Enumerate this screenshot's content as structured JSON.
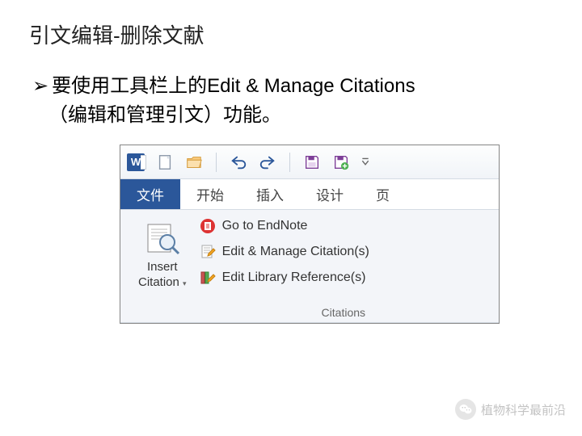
{
  "slide": {
    "title": "引文编辑-删除文献",
    "bullet_marker": "➢",
    "bullet_line1": "要使用工具栏上的Edit & Manage Citations",
    "bullet_line2": "（编辑和管理引文）功能。"
  },
  "word": {
    "app_icon_letter": "W",
    "tabs": {
      "file": "文件",
      "home": "开始",
      "insert": "插入",
      "design": "设计",
      "page": "页"
    },
    "ribbon": {
      "insert_citation_line1": "Insert",
      "insert_citation_line2": "Citation",
      "go_endnote": "Go to EndNote",
      "edit_manage": "Edit & Manage Citation(s)",
      "edit_library": "Edit Library Reference(s)",
      "group_label": "Citations"
    }
  },
  "watermark": {
    "text": "植物科学最前沿"
  }
}
